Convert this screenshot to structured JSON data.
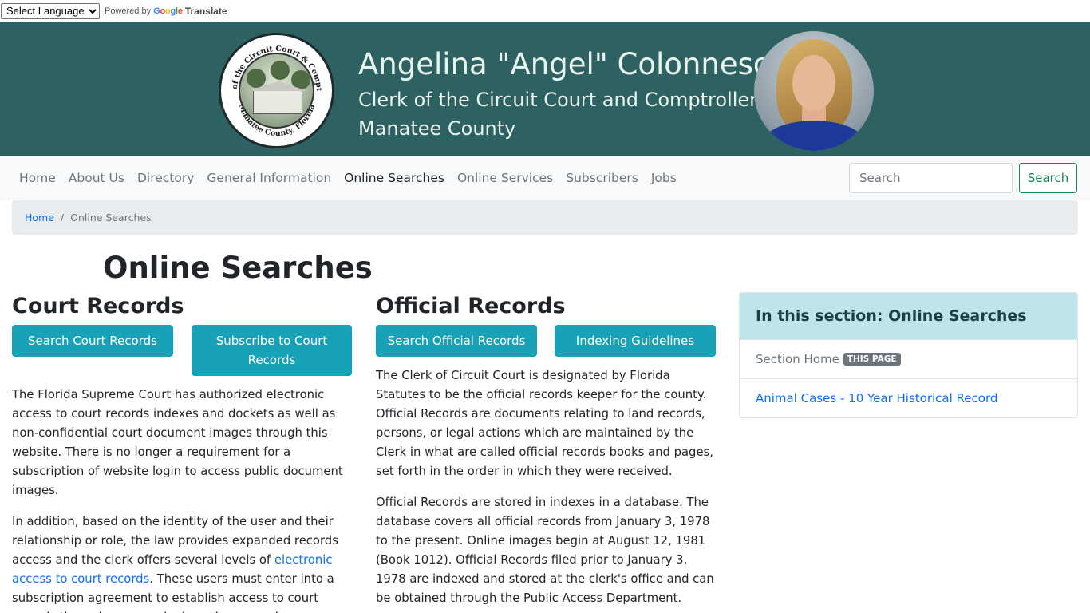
{
  "translate": {
    "select_label": "Select Language",
    "powered_by": "Powered by",
    "google": "Google",
    "translate": "Translate"
  },
  "seal": {
    "top_text": "Clerk of the Circuit Court & Comptroller",
    "bottom_text": "Manatee County, Florida"
  },
  "header": {
    "title": "Angelina \"Angel\" Colonneso",
    "subtitle": "Clerk of the Circuit Court and Comptroller",
    "county": "Manatee County"
  },
  "nav": {
    "items": [
      {
        "label": "Home",
        "active": false
      },
      {
        "label": "About Us",
        "active": false
      },
      {
        "label": "Directory",
        "active": false
      },
      {
        "label": "General Information",
        "active": false
      },
      {
        "label": "Online Searches",
        "active": true
      },
      {
        "label": "Online Services",
        "active": false
      },
      {
        "label": "Subscribers",
        "active": false
      },
      {
        "label": "Jobs",
        "active": false
      }
    ],
    "search_placeholder": "Search",
    "search_button": "Search"
  },
  "breadcrumb": {
    "home": "Home",
    "separator": "/",
    "current": "Online Searches"
  },
  "page": {
    "title": "Online Searches"
  },
  "court": {
    "heading": "Court Records",
    "btn_search": "Search Court Records",
    "btn_subscribe": "Subscribe to Court Records",
    "para1": "The Florida Supreme Court has authorized  electronic access to court records indexes and dockets as well as non-confidential court document images through this website. There is no longer a requirement for a subscription of website login to access public document images.",
    "para2_before": "In addition, based on the identity of the user and their relationship or role, the law provides expanded records access and the clerk offers several levels of ",
    "para2_link": "electronic access to court records",
    "para2_after": ". These users must enter into a subscription agreement to establish access to court records through a secure login and password."
  },
  "official": {
    "heading": "Official Records",
    "btn_search": "Search Official Records",
    "btn_indexing": "Indexing Guidelines",
    "para1": "The Clerk of Circuit Court is designated by Florida Statutes to be the official records keeper for the county. Official Records are documents relating to land records, persons, or legal actions which are maintained by the Clerk in what are called official records books and pages, set forth in the order in which they were received.",
    "para2": "Official Records are stored in indexes in a database. The database covers all official records from January 3, 1978 to the present. Online images begin at August 12, 1981 (Book 1012). Official Records filed prior to January 3, 1978 are indexed and stored at the clerk's office and can be obtained through the Public Access Department."
  },
  "sidebar": {
    "heading": "In this section: Online Searches",
    "section_home": "Section Home",
    "badge": "THIS PAGE",
    "link1": "Animal Cases - 10 Year Historical Record"
  },
  "colors": {
    "banner": "#2e6262",
    "info_button": "#17a2b8",
    "search_button": "#198754",
    "card_header": "#bfe5ea"
  }
}
